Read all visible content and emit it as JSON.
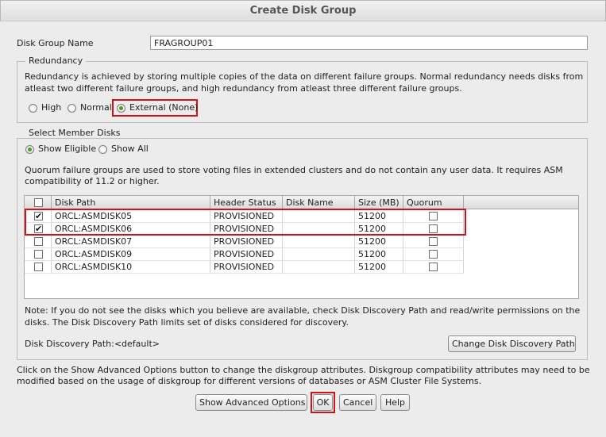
{
  "dialog": {
    "title": "Create Disk Group"
  },
  "disk_group_name": {
    "label": "Disk Group Name",
    "value": "FRAGROUP01"
  },
  "redundancy": {
    "legend": "Redundancy",
    "description_line1": "Redundancy is achieved by storing multiple copies of the data on different failure groups. Normal redundancy needs disks from",
    "description_line2": "atleast two different failure groups, and high redundancy from atleast three different failure groups.",
    "options": [
      {
        "label": "High",
        "selected": false
      },
      {
        "label": "Normal",
        "selected": false
      },
      {
        "label": "External (None)",
        "selected": true
      }
    ]
  },
  "member_disks": {
    "legend": "Select Member Disks",
    "filter_options": [
      {
        "label": "Show Eligible",
        "selected": true
      },
      {
        "label": "Show All",
        "selected": false
      }
    ],
    "quorum_note_line1": "Quorum failure groups are used to store voting files in extended clusters and do not contain any user data. It requires ASM",
    "quorum_note_line2": "compatibility of 11.2 or higher.",
    "columns": [
      "Disk Path",
      "Header Status",
      "Disk Name",
      "Size (MB)",
      "Quorum"
    ],
    "rows": [
      {
        "checked": true,
        "path": "ORCL:ASMDISK05",
        "status": "PROVISIONED",
        "name": "",
        "size": "51200",
        "quorum": false
      },
      {
        "checked": true,
        "path": "ORCL:ASMDISK06",
        "status": "PROVISIONED",
        "name": "",
        "size": "51200",
        "quorum": false
      },
      {
        "checked": false,
        "path": "ORCL:ASMDISK07",
        "status": "PROVISIONED",
        "name": "",
        "size": "51200",
        "quorum": false
      },
      {
        "checked": false,
        "path": "ORCL:ASMDISK09",
        "status": "PROVISIONED",
        "name": "",
        "size": "51200",
        "quorum": false
      },
      {
        "checked": false,
        "path": "ORCL:ASMDISK10",
        "status": "PROVISIONED",
        "name": "",
        "size": "51200",
        "quorum": false
      }
    ],
    "discovery_note_line1": "Note: If you do not see the disks which you believe are available, check Disk Discovery Path and read/write permissions on the",
    "discovery_note_line2": "disks. The Disk Discovery Path limits set of disks considered for discovery.",
    "discovery_path": "Disk Discovery Path:<default>",
    "change_path_button": "Change Disk Discovery Path"
  },
  "advanced_note_line1": "Click on the Show Advanced Options button to change the diskgroup attributes. Diskgroup compatibility attributes may need to be",
  "advanced_note_line2": "modified based on the usage of diskgroup for different versions of databases or ASM Cluster File Systems.",
  "buttons": {
    "advanced": "Show Advanced Options",
    "ok": "OK",
    "cancel": "Cancel",
    "help": "Help"
  },
  "colors": {
    "highlight": "#d0121b",
    "radio_selected": "#4a9a28"
  }
}
